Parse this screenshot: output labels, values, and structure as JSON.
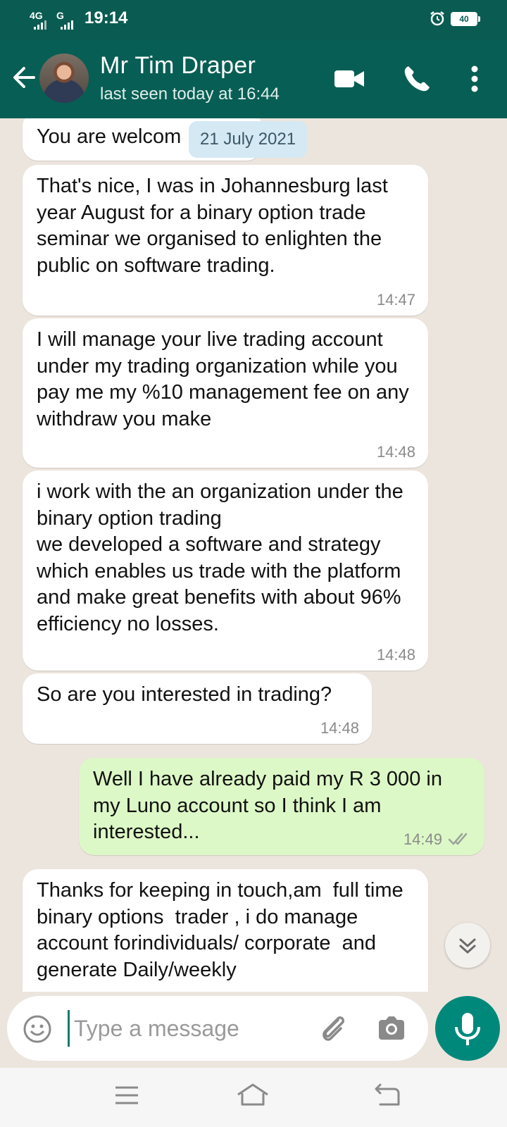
{
  "status_bar": {
    "signal1": "4G",
    "signal2": "G",
    "time": "19:14",
    "battery": "40"
  },
  "header": {
    "contact_name": "Mr Tim Draper",
    "last_seen": "last seen today at 16:44",
    "icons": [
      "back-arrow-icon",
      "video-call-icon",
      "phone-call-icon",
      "more-options-icon"
    ]
  },
  "chat": {
    "date_chip": "21 July 2021",
    "messages": [
      {
        "direction": "in",
        "text": "You are welcom",
        "time": ""
      },
      {
        "direction": "in",
        "text": "That's nice, I was in Johannesburg last year August for a binary option trade seminar we organised to enlighten the public on software trading.",
        "time": "14:47"
      },
      {
        "direction": "in",
        "text": "I will manage your live trading account under my trading organization while you pay me my %10 management fee on any withdraw you make",
        "time": "14:48"
      },
      {
        "direction": "in",
        "text": "i work with the an organization under the binary option trading\nwe developed a software and strategy which enables us trade with the platform and make great benefits with about 96% efficiency no losses.",
        "time": "14:48"
      },
      {
        "direction": "in",
        "text": "So are you interested in trading?",
        "time": "14:48"
      },
      {
        "direction": "out",
        "text": "Well I have already paid my R 3 000 in my Luno account so I think I am interested...",
        "time": "14:49",
        "status": "read"
      },
      {
        "direction": "in",
        "text": "Thanks for keeping in touch,am  full time binary options  trader , i do manage account forindividuals/ corporate  and generate Daily/weekly",
        "time": ""
      }
    ]
  },
  "composer": {
    "placeholder": "Type a message",
    "value": ""
  },
  "colors": {
    "header": "#075e54",
    "status_bar": "#0a5c52",
    "outgoing_bubble": "#dcf8c6",
    "chat_background": "#ece5dd",
    "mic_button": "#00897b"
  }
}
